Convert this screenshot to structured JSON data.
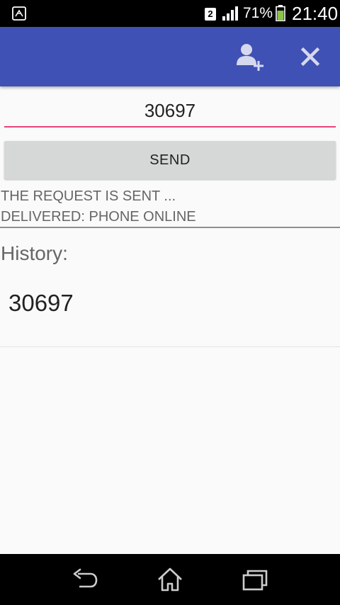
{
  "status_bar": {
    "sim_slot": "2",
    "battery_percent": "71%",
    "time": "21:40"
  },
  "action_bar": {
    "icons": [
      "add-contact-icon",
      "close-icon"
    ],
    "color": "#3f51b5"
  },
  "form": {
    "number_value": "30697",
    "accent_color": "#e8437a"
  },
  "send_button": {
    "label": "SEND"
  },
  "status": {
    "line1": "THE REQUEST IS SENT ...",
    "line2": "DELIVERED: PHONE ONLINE"
  },
  "history": {
    "title": "History:",
    "items": [
      {
        "number": "30697"
      }
    ]
  },
  "nav_bar": {
    "icons": [
      "back-icon",
      "home-icon",
      "recent-apps-icon"
    ]
  }
}
